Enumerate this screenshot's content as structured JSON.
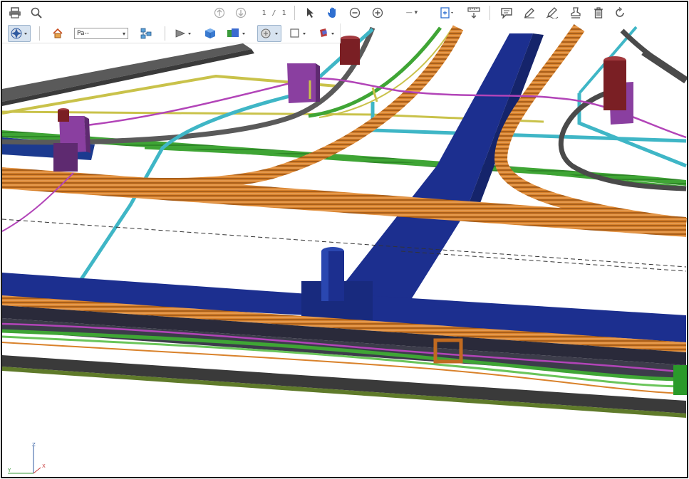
{
  "toolbar": {
    "print_icon": "printer-icon",
    "search_icon": "magnifier-icon",
    "page_indicator": "1 / 1",
    "zoom_label": "—"
  },
  "toolbar2": {
    "view_selector": "Pa--"
  },
  "axes": {
    "z": "Z",
    "y": "Y",
    "x": "X"
  },
  "colors": {
    "duct_blue": "#1c2f8f",
    "cable_orange": "#d9822b",
    "pipe_cyan": "#3fb6c6",
    "pipe_green": "#3fa535",
    "pipe_gray": "#4a4a4a",
    "pipe_yellow": "#c9c24a",
    "pipe_magenta": "#b244b8",
    "box_purple": "#8a3fa0",
    "cylinder_red": "#7a1f24"
  }
}
